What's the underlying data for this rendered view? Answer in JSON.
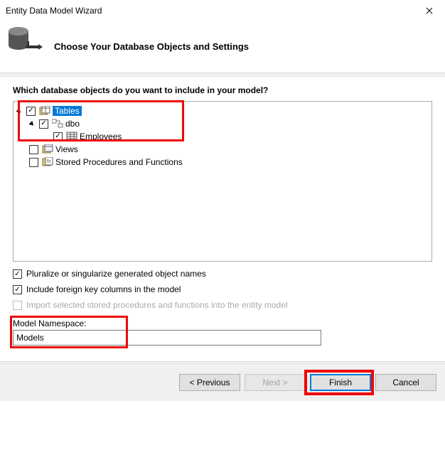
{
  "window": {
    "title": "Entity Data Model Wizard"
  },
  "header": {
    "heading": "Choose Your Database Objects and Settings"
  },
  "main": {
    "question": "Which database objects do you want to include in your model?",
    "tree": {
      "tables": {
        "label": "Tables",
        "checked": true,
        "expanded": true
      },
      "dbo": {
        "label": "dbo",
        "checked": true,
        "expanded": true
      },
      "employees": {
        "label": "Employees",
        "checked": true
      },
      "views": {
        "label": "Views",
        "checked": false
      },
      "sprocs": {
        "label": "Stored Procedures and Functions",
        "checked": false
      }
    }
  },
  "options": {
    "pluralize": {
      "label": "Pluralize or singularize generated object names",
      "checked": true
    },
    "foreignKeys": {
      "label": "Include foreign key columns in the model",
      "checked": true
    },
    "importSprocs": {
      "label": "Import selected stored procedures and functions into the entity model",
      "checked": false
    }
  },
  "namespace": {
    "label": "Model Namespace:",
    "value": "Models"
  },
  "footer": {
    "previous": "< Previous",
    "next": "Next >",
    "finish": "Finish",
    "cancel": "Cancel"
  }
}
